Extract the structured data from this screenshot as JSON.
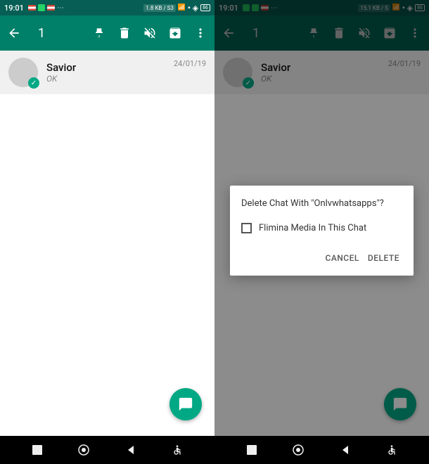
{
  "left": {
    "status": {
      "time": "19:01",
      "data_rate": "1.8 KB / S3",
      "battery": "86"
    },
    "action_bar": {
      "count": "1"
    },
    "chat": {
      "name": "Savior",
      "preview": "OK",
      "date": "24/01/19"
    }
  },
  "right": {
    "status": {
      "time": "19:01",
      "data_rate": "15.1 KB / S",
      "battery": "86"
    },
    "action_bar": {
      "count": "1"
    },
    "chat": {
      "name": "Savior",
      "preview": "OK",
      "date": "24/01/19"
    },
    "dialog": {
      "title": "Delete Chat With \"Onlvwhatsapps\"?",
      "checkbox_label": "Flimina Media In This Chat",
      "cancel": "CANCEL",
      "delete": "DELETE"
    }
  }
}
